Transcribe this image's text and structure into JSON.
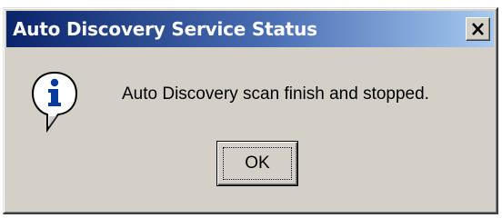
{
  "dialog": {
    "title": "Auto Discovery Service Status",
    "close_label": "X",
    "icon": "information-icon",
    "message": "Auto Discovery scan finish and stopped.",
    "ok_label": "OK"
  },
  "colors": {
    "title_bar_start": "#0a246a",
    "title_bar_end": "#a6caf0",
    "window_face": "#d4d0c8",
    "icon_blue": "#0a3a9e"
  }
}
